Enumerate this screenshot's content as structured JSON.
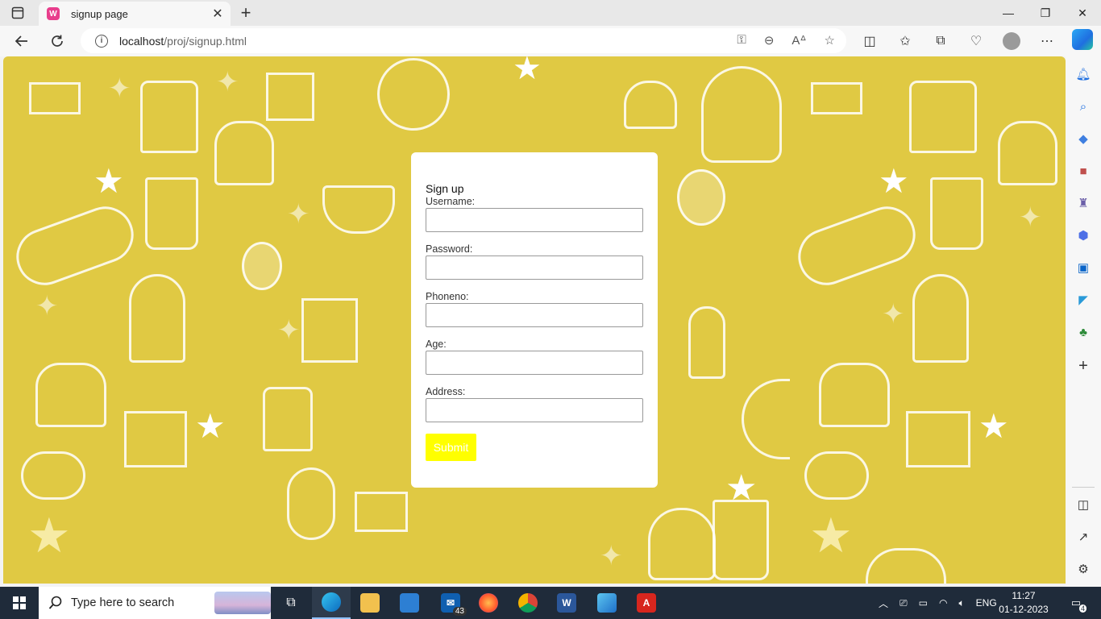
{
  "browser": {
    "tab_title": "signup page",
    "tab_favicon": "W",
    "url_host": "localhost",
    "url_path": "/proj/signup.html",
    "minimize": "—",
    "restore": "❐",
    "close": "✕"
  },
  "form": {
    "heading": "Sign up",
    "username_label": "Username:",
    "password_label": "Password:",
    "phone_label": "Phoneno:",
    "age_label": "Age:",
    "address_label": "Address:",
    "username_value": "",
    "password_value": "",
    "phone_value": "",
    "age_value": "",
    "address_value": "",
    "submit_label": "Submit",
    "submit_color": "#ffff00"
  },
  "page": {
    "background_color": "#e0c943"
  },
  "taskbar": {
    "search_placeholder": "Type here to search",
    "mail_badge": "43",
    "language": "ENG",
    "time": "11:27",
    "date": "01-12-2023",
    "notification_count": "4"
  }
}
